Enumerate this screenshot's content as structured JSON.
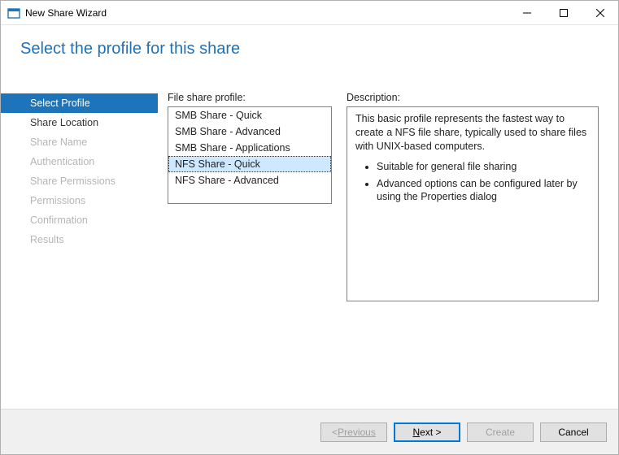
{
  "window": {
    "title": "New Share Wizard"
  },
  "header": {
    "heading": "Select the profile for this share"
  },
  "steps": [
    {
      "label": "Select Profile",
      "state": "selected"
    },
    {
      "label": "Share Location",
      "state": "enabled"
    },
    {
      "label": "Share Name",
      "state": "disabled"
    },
    {
      "label": "Authentication",
      "state": "disabled"
    },
    {
      "label": "Share Permissions",
      "state": "disabled"
    },
    {
      "label": "Permissions",
      "state": "disabled"
    },
    {
      "label": "Confirmation",
      "state": "disabled"
    },
    {
      "label": "Results",
      "state": "disabled"
    }
  ],
  "content": {
    "profile_label": "File share profile:",
    "description_label": "Description:",
    "profiles": [
      {
        "label": "SMB Share - Quick",
        "selected": false
      },
      {
        "label": "SMB Share - Advanced",
        "selected": false
      },
      {
        "label": "SMB Share - Applications",
        "selected": false
      },
      {
        "label": "NFS Share - Quick",
        "selected": true
      },
      {
        "label": "NFS Share - Advanced",
        "selected": false
      }
    ],
    "description_intro": "This basic profile represents the fastest way to create a NFS file share, typically used to share files with UNIX-based computers.",
    "description_bullets": [
      "Suitable for general file sharing",
      "Advanced options can be configured later by using the Properties dialog"
    ]
  },
  "footer": {
    "previous": "Previous",
    "next": "Next >",
    "create": "Create",
    "cancel": "Cancel"
  }
}
